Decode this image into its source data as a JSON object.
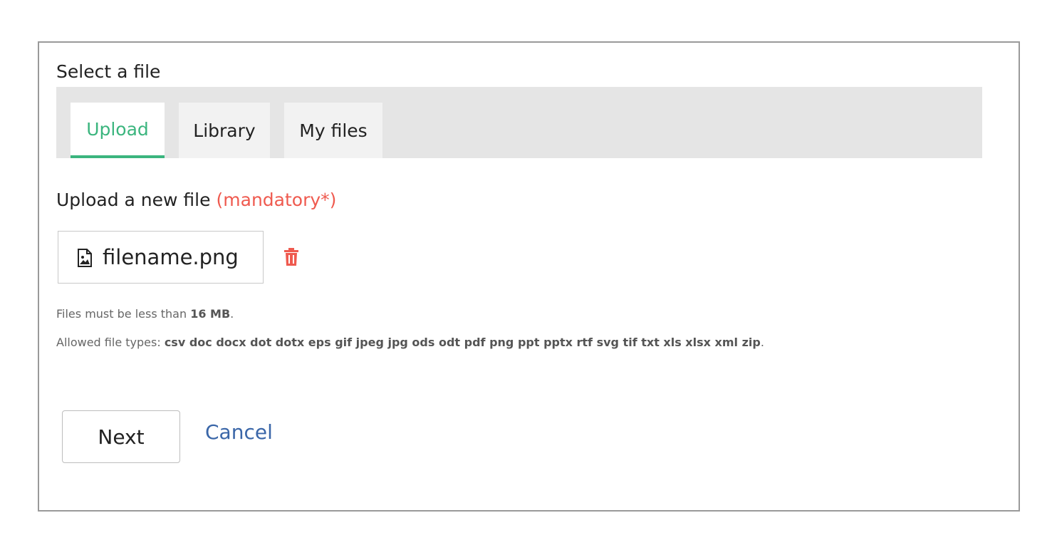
{
  "dialog": {
    "title": "Select a file",
    "tabs": [
      {
        "label": "Upload",
        "active": true
      },
      {
        "label": "Library",
        "active": false
      },
      {
        "label": "My files",
        "active": false
      }
    ],
    "upload": {
      "label": "Upload a new file",
      "mandatory": "(mandatory*)",
      "file_name": "filename.png",
      "file_icon": "image-file-icon",
      "delete_icon": "trash-icon"
    },
    "hints": {
      "size_prefix": "Files must be less than",
      "size_value": "16 MB",
      "size_suffix": ".",
      "types_prefix": "Allowed file types:",
      "types_value": "csv doc docx dot dotx eps gif jpeg jpg ods odt pdf png ppt pptx rtf svg tif txt xls xlsx xml zip",
      "types_suffix": "."
    },
    "actions": {
      "next_label": "Next",
      "cancel_label": "Cancel"
    }
  },
  "colors": {
    "accent": "#3bb57e",
    "mandatory": "#ef5a4f",
    "link": "#3a66a8",
    "delete": "#ef5a4f"
  }
}
